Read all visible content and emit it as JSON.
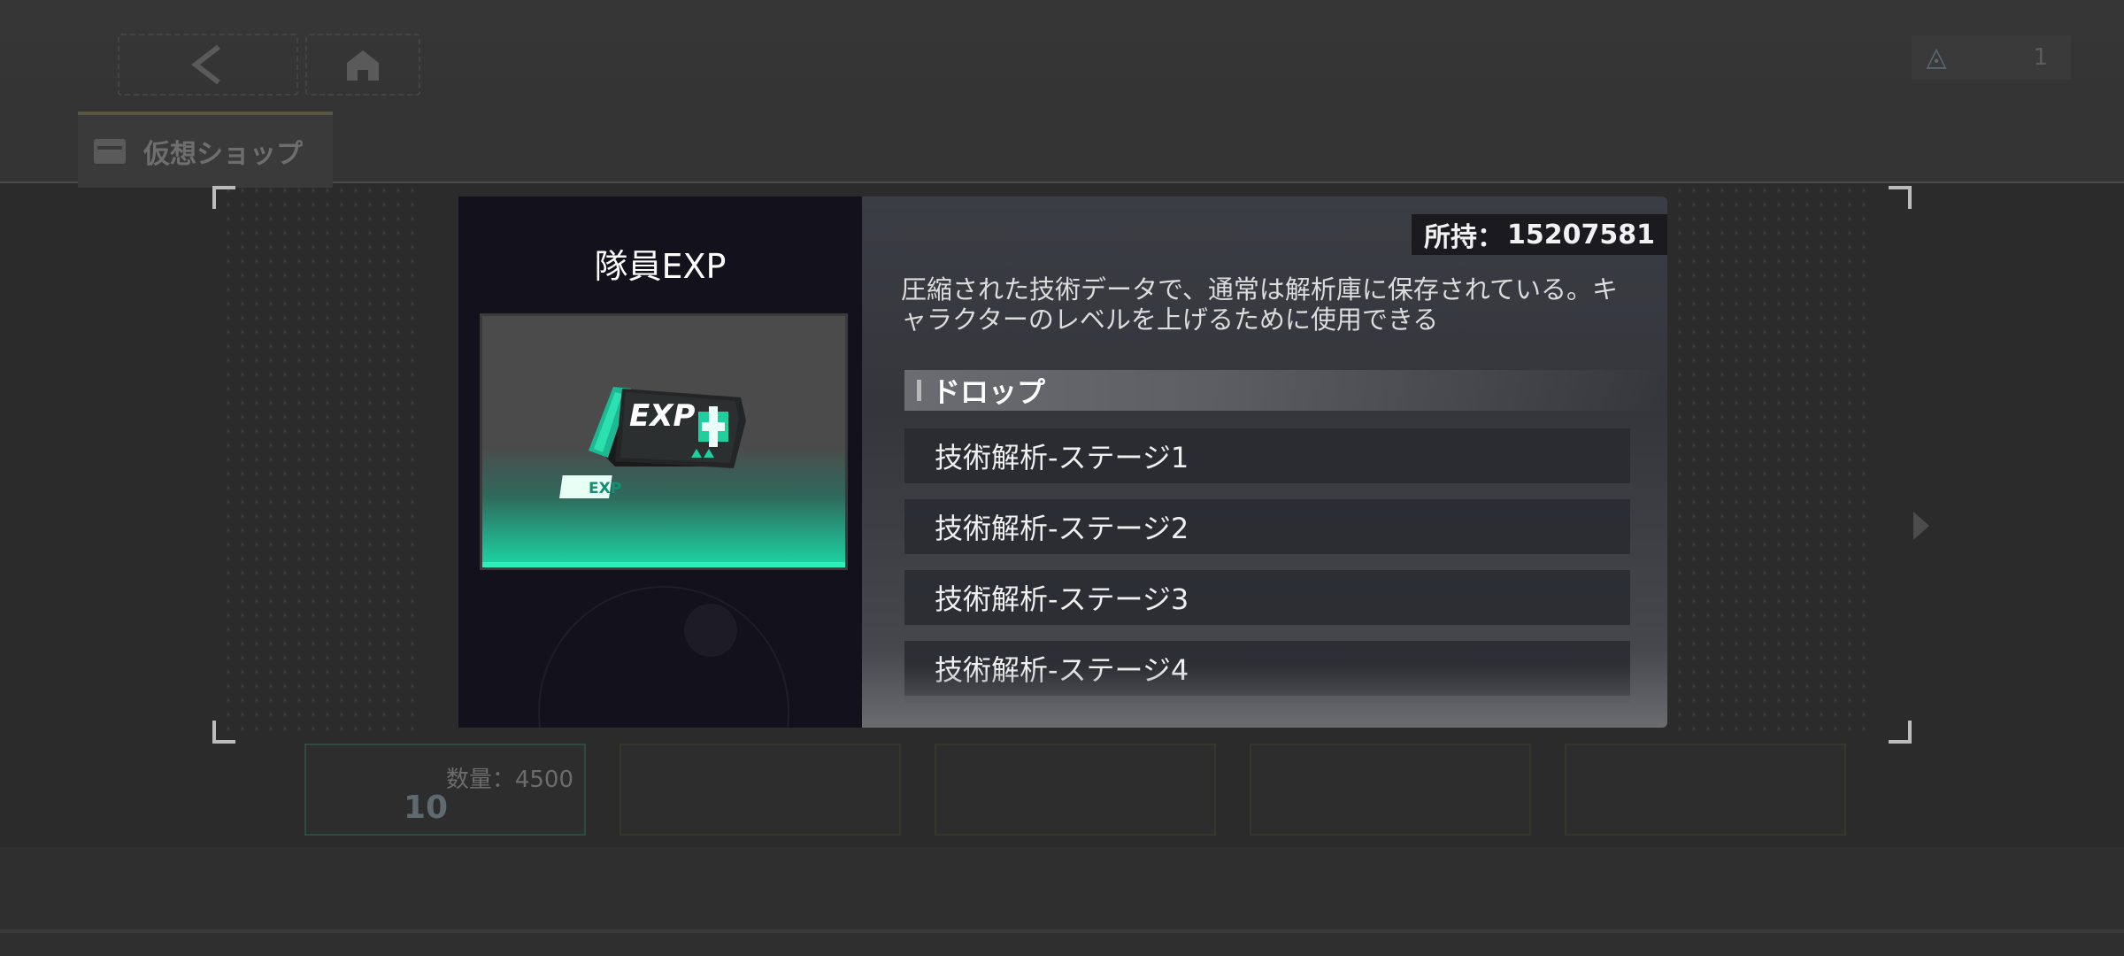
{
  "header": {
    "back_icon": "chevron-left-icon",
    "home_icon": "home-icon",
    "shop_tab_label": "仮想ショップ",
    "currency_icon": "currency-icon",
    "currency_value": "1"
  },
  "background_shop": {
    "card_quantity": "数量：4500",
    "card_price": "10"
  },
  "modal": {
    "item_name": "隊員EXP",
    "owned_label": "所持：",
    "owned_value": "15207581",
    "description": "圧縮された技術データで、通常は解析庫に保存されている。キャラクターのレベルを上げるために使用できる",
    "drop_header": "ドロップ",
    "drop_items": [
      "技術解析-ステージ1",
      "技術解析-ステージ2",
      "技術解析-ステージ3",
      "技術解析-ステージ4"
    ],
    "item_image": {
      "badge_text": "EXP",
      "small_badge_text": "EXP"
    }
  },
  "colors": {
    "accent_teal": "#1bd8a5",
    "left_panel_bg": "#13121c",
    "right_panel_bg": "#3b3d44"
  }
}
